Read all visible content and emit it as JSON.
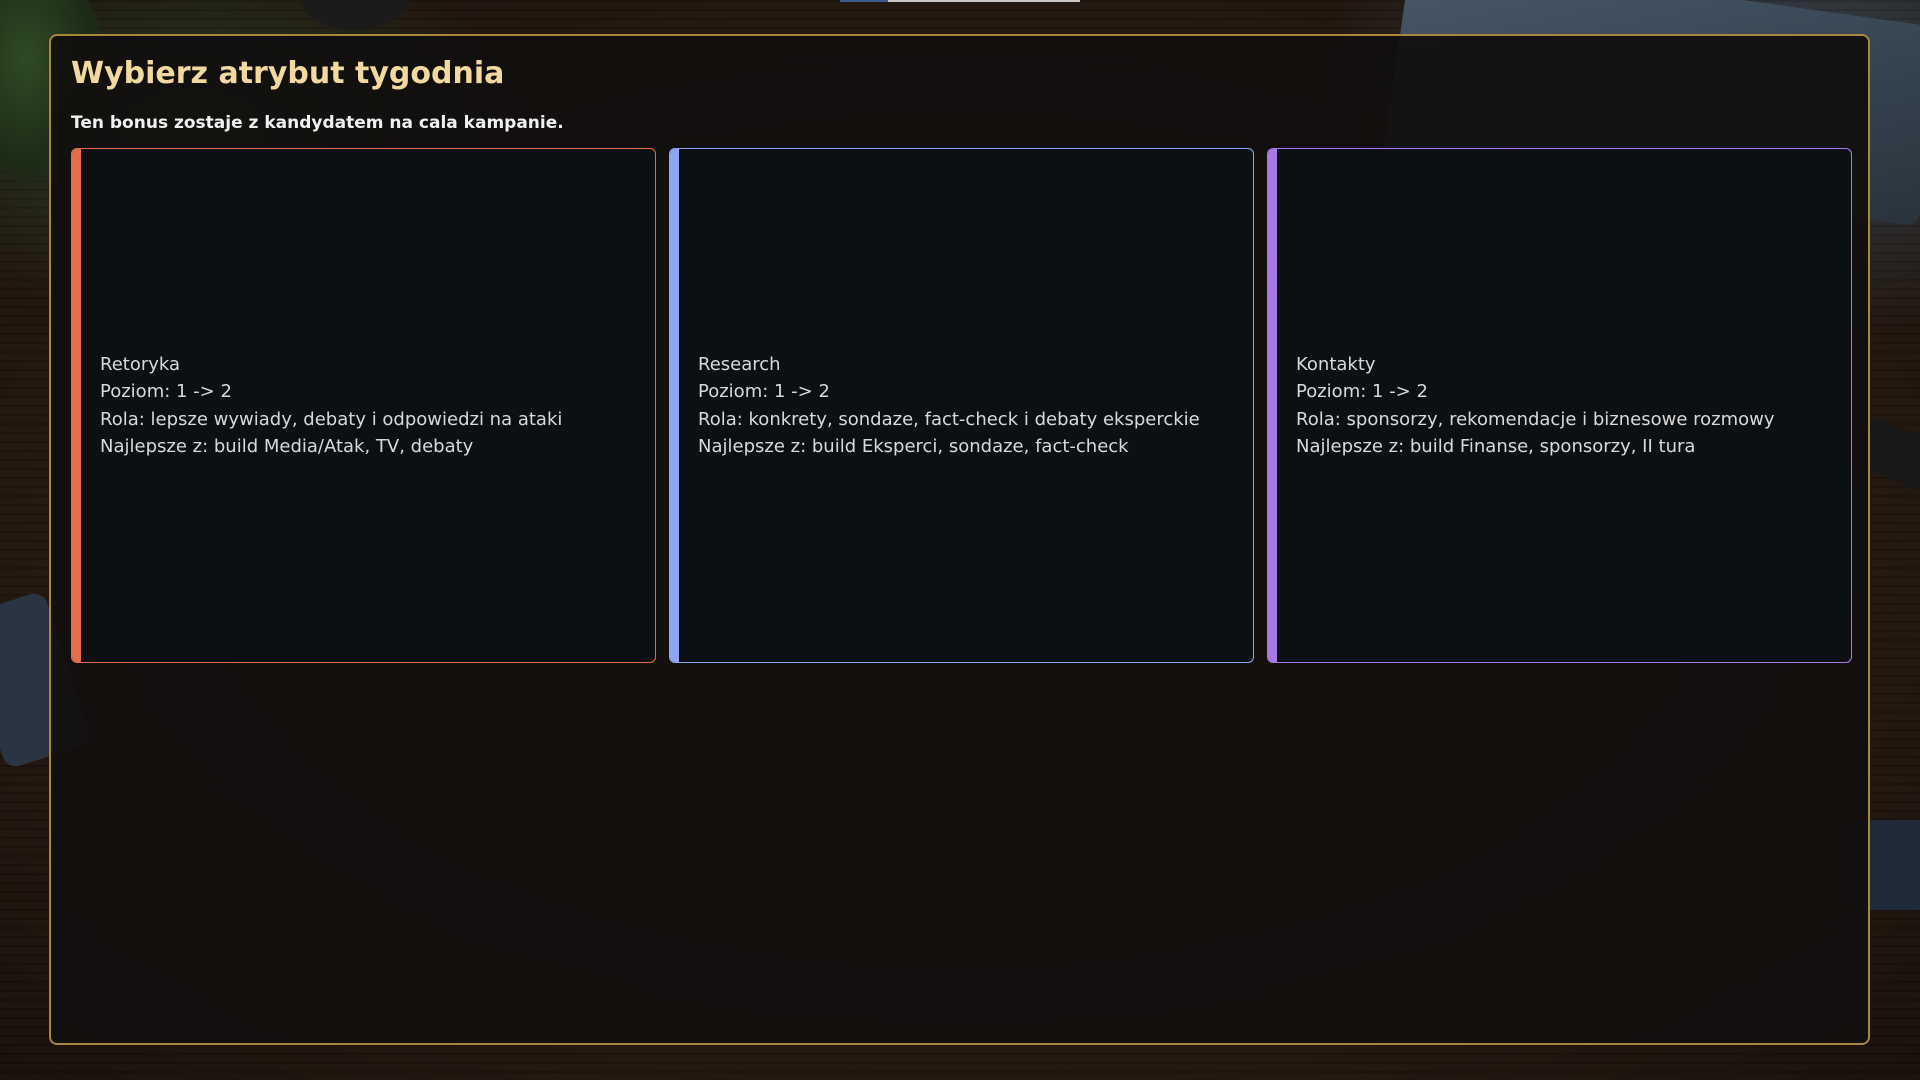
{
  "dialog": {
    "title": "Wybierz atrybut tygodnia",
    "subtitle": "Ten bonus zostaje z kandydatem na cala kampanie."
  },
  "cards": [
    {
      "name": "Retoryka",
      "level": "Poziom: 1 -> 2",
      "role": "Rola: lepsze wywiady, debaty i odpowiedzi na ataki",
      "best": "Najlepsze z: build Media/Atak, TV, debaty",
      "accent_color": "#e36d4c"
    },
    {
      "name": "Research",
      "level": "Poziom: 1 -> 2",
      "role": "Rola: konkrety, sondaze, fact-check i debaty eksperckie",
      "best": "Najlepsze z: build Eksperci, sondaze, fact-check",
      "accent_color": "#8ea6f5"
    },
    {
      "name": "Kontakty",
      "level": "Poziom: 1 -> 2",
      "role": "Rola: sponsorzy, rekomendacje i biznesowe rozmowy",
      "best": "Najlepsze z: build Finanse, sponsorzy, II tura",
      "accent_color": "#a87ae8"
    }
  ],
  "theme": {
    "panel_border": "#a8873a",
    "title_color": "#f2d9a0"
  }
}
